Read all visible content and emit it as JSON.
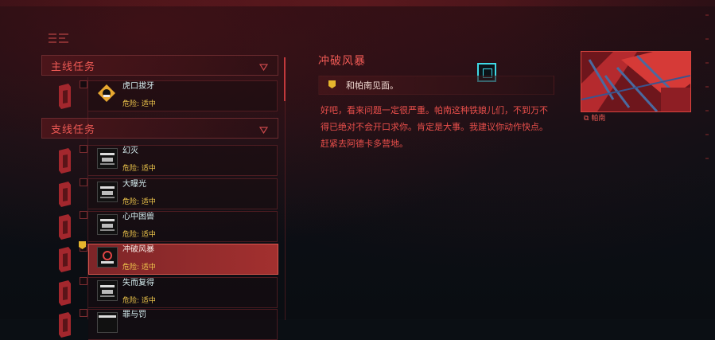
{
  "logo_icon": "game-logo-icon",
  "sections": {
    "main": {
      "label": "主线任务",
      "icon": "collapse-triangle-icon"
    },
    "side": {
      "label": "支线任务",
      "icon": "collapse-triangle-icon"
    }
  },
  "main_quests": [
    {
      "name": "虎口拔牙",
      "danger": "危险: 适中",
      "icon": "faction-icon"
    }
  ],
  "side_quests": [
    {
      "name": "幻灭",
      "danger": "危险: 适中",
      "icon": "watson-district-icon"
    },
    {
      "name": "大曝光",
      "danger": "危险: 适中",
      "icon": "watson-district-icon"
    },
    {
      "name": "心中困兽",
      "danger": "危险: 适中",
      "icon": "watson-district-icon"
    },
    {
      "name": "冲破风暴",
      "danger": "危险: 适中",
      "icon": "city-south-icon",
      "active": true
    },
    {
      "name": "失而复得",
      "danger": "危险: 适中",
      "icon": "watson-district-icon"
    },
    {
      "name": "罪与罚",
      "danger": "",
      "icon": "district-icon"
    }
  ],
  "detail": {
    "title": "冲破风暴",
    "objective": "和帕南见面。",
    "description": "好吧，看来问题一定很严重。帕南这种铁娘儿们，不到万不得已绝对不会开口求你。肯定是大事。我建议你动作快点。赶紧去阿德卡多营地。",
    "contact_name": "帕南",
    "contact_icon": "contact-link-icon"
  },
  "colors": {
    "accent": "#ef5a55",
    "danger": "#f2c94c",
    "active_bg": "#a3302f",
    "cyan": "#3fd9e6"
  }
}
